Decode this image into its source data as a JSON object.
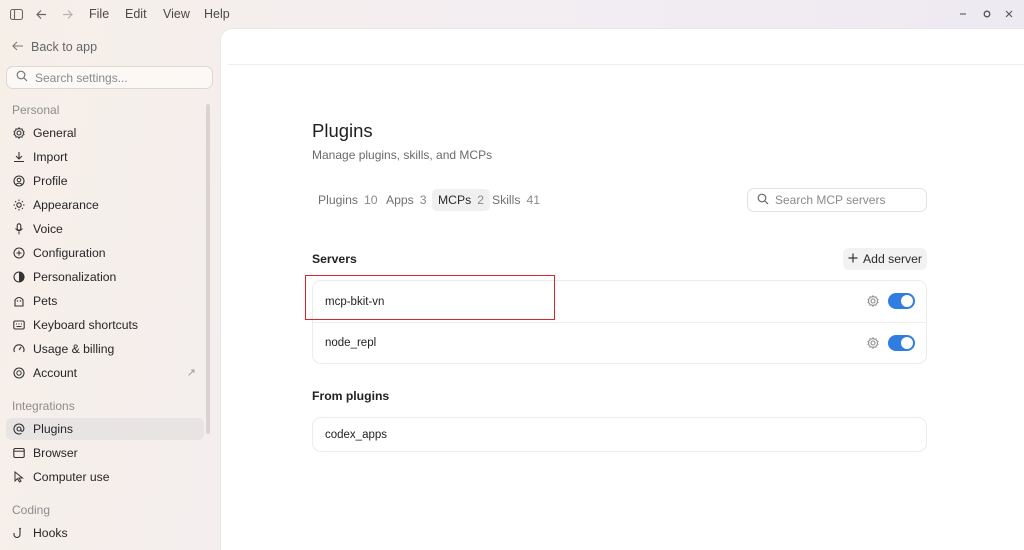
{
  "titlebar": {
    "menus": [
      "File",
      "Edit",
      "View",
      "Help"
    ]
  },
  "sidebar": {
    "back_label": "Back to app",
    "search_placeholder": "Search settings...",
    "sections": {
      "personal": "Personal",
      "integrations": "Integrations",
      "coding": "Coding"
    },
    "items": [
      {
        "label": "General",
        "icon": "gear-icon"
      },
      {
        "label": "Import",
        "icon": "download-icon"
      },
      {
        "label": "Profile",
        "icon": "profile-icon"
      },
      {
        "label": "Appearance",
        "icon": "sun-icon"
      },
      {
        "label": "Voice",
        "icon": "microphone-icon"
      },
      {
        "label": "Configuration",
        "icon": "config-icon"
      },
      {
        "label": "Personalization",
        "icon": "personalization-icon"
      },
      {
        "label": "Pets",
        "icon": "pet-icon"
      },
      {
        "label": "Keyboard shortcuts",
        "icon": "keyboard-icon"
      },
      {
        "label": "Usage & billing",
        "icon": "usage-icon"
      },
      {
        "label": "Account",
        "icon": "account-icon"
      },
      {
        "label": "Plugins",
        "icon": "at-icon"
      },
      {
        "label": "Browser",
        "icon": "browser-icon"
      },
      {
        "label": "Computer use",
        "icon": "cursor-icon"
      },
      {
        "label": "Hooks",
        "icon": "hook-icon"
      }
    ]
  },
  "main": {
    "title": "Plugins",
    "subtitle": "Manage plugins, skills, and MCPs",
    "tabs": [
      {
        "label": "Plugins",
        "count": "10"
      },
      {
        "label": "Apps",
        "count": "3"
      },
      {
        "label": "MCPs",
        "count": "2"
      },
      {
        "label": "Skills",
        "count": "41"
      }
    ],
    "search_placeholder": "Search MCP servers",
    "servers_label": "Servers",
    "add_server_label": "Add server",
    "servers": [
      {
        "name": "mcp-bkit-vn",
        "enabled": true
      },
      {
        "name": "node_repl",
        "enabled": true
      }
    ],
    "from_plugins_label": "From plugins",
    "plugin_servers": [
      {
        "name": "codex_apps"
      }
    ]
  },
  "colors": {
    "accent": "#2f7de1",
    "highlight": "#d8262a"
  }
}
